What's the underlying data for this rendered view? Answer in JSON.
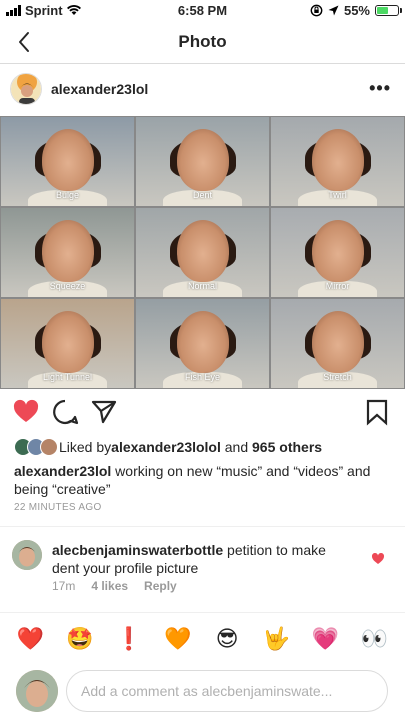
{
  "status_bar": {
    "carrier": "Sprint",
    "time": "6:58 PM",
    "battery_percent": "55%",
    "battery_level": 0.55
  },
  "header": {
    "title": "Photo"
  },
  "post": {
    "username": "alexander23lol",
    "more_icon": "•••",
    "tiles": [
      {
        "label": "Bulge",
        "bg": "#8d9aa6"
      },
      {
        "label": "Dent",
        "bg": "#9aa3a8"
      },
      {
        "label": "Twirl",
        "bg": "#a4a9ad"
      },
      {
        "label": "Squeeze",
        "bg": "#8f9794"
      },
      {
        "label": "Normal",
        "bg": "#a0a6a8"
      },
      {
        "label": "Mirror",
        "bg": "#a8acb0"
      },
      {
        "label": "Light Tunnel",
        "bg": "#b9a48c"
      },
      {
        "label": "Fish Eye",
        "bg": "#959ea3"
      },
      {
        "label": "Stretch",
        "bg": "#a6aaae"
      }
    ],
    "liked_prefix": "Liked by ",
    "liked_user": "alexander23lolol",
    "liked_and": " and ",
    "liked_count": "965 others",
    "caption_user": "alexander23lol",
    "caption_text": " working on new “music” and “videos” and being “creative”",
    "time_ago": "22 MINUTES AGO"
  },
  "comment": {
    "username": "alecbenjaminswaterbottle",
    "text": " petition to make dent your profile picture",
    "time": "17m",
    "likes": "4 likes",
    "reply": "Reply"
  },
  "emojis": [
    {
      "char": "❤️",
      "name": "red-heart-emoji"
    },
    {
      "char": "🤩",
      "name": "star-struck-emoji"
    },
    {
      "char": "❗",
      "name": "exclamation-emoji"
    },
    {
      "char": "🧡",
      "name": "orange-heart-emoji"
    },
    {
      "char": "😎",
      "name": "sunglasses-emoji"
    },
    {
      "char": "🤟",
      "name": "love-you-gesture-emoji"
    },
    {
      "char": "💗",
      "name": "growing-heart-emoji"
    },
    {
      "char": "👀",
      "name": "eyes-emoji"
    }
  ],
  "input": {
    "placeholder": "Add a comment as alecbenjaminswate..."
  },
  "colors": {
    "like_red": "#ed4956",
    "text": "#262626",
    "muted": "#999999"
  }
}
